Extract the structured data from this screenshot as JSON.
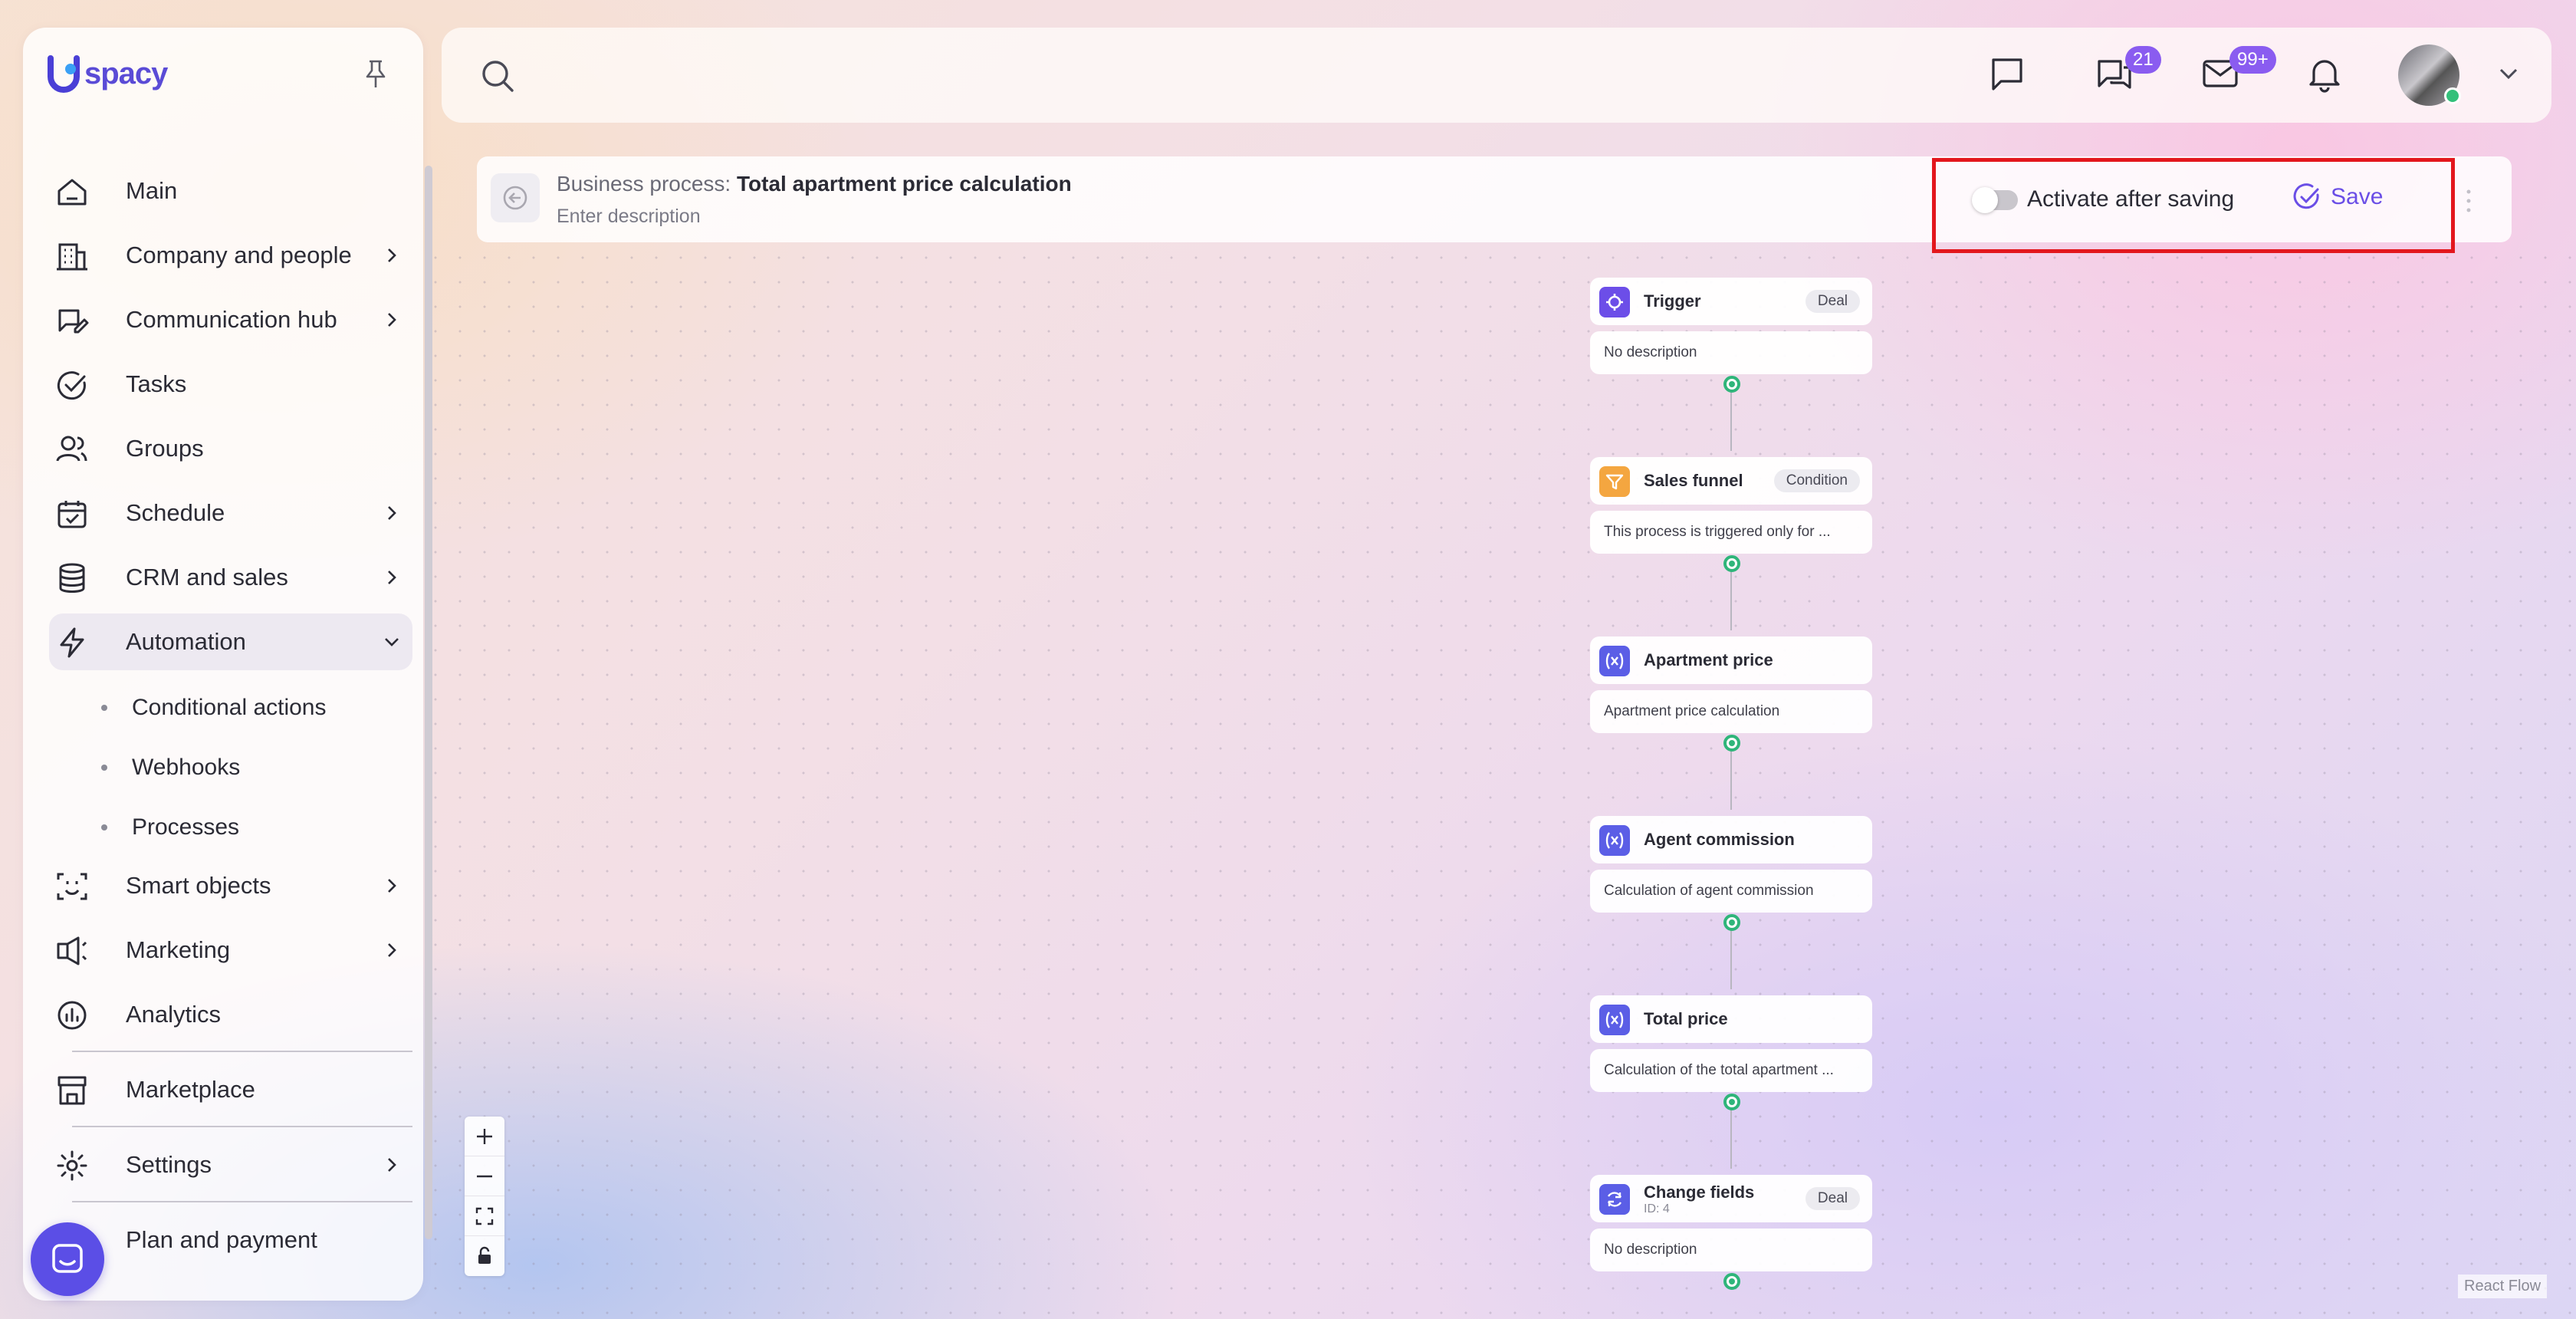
{
  "app": {
    "logo_text": "spacy"
  },
  "sidebar": {
    "items": [
      {
        "label": "Main",
        "icon": "home-icon"
      },
      {
        "label": "Company and people",
        "icon": "building-icon",
        "has_submenu": true
      },
      {
        "label": "Communication hub",
        "icon": "chat-edit-icon",
        "has_submenu": true
      },
      {
        "label": "Tasks",
        "icon": "check-circle-icon"
      },
      {
        "label": "Groups",
        "icon": "users-icon"
      },
      {
        "label": "Schedule",
        "icon": "calendar-icon",
        "has_submenu": true
      },
      {
        "label": "CRM and sales",
        "icon": "database-icon",
        "has_submenu": true
      },
      {
        "label": "Automation",
        "icon": "lightning-icon",
        "has_submenu": true,
        "expanded": true
      }
    ],
    "automation_sub": [
      "Conditional actions",
      "Webhooks",
      "Processes"
    ],
    "items2": [
      {
        "label": "Smart objects",
        "icon": "scan-face-icon",
        "has_submenu": true
      },
      {
        "label": "Marketing",
        "icon": "megaphone-icon",
        "has_submenu": true
      },
      {
        "label": "Analytics",
        "icon": "chart-circle-icon"
      }
    ],
    "marketplace": "Marketplace",
    "settings": "Settings",
    "plan": "Plan and payment"
  },
  "topbar": {
    "chat_badge": "21",
    "mail_badge": "99+",
    "accent": "#8a5cf0"
  },
  "process": {
    "prefix": "Business process:",
    "title": "Total apartment price calculation",
    "description_placeholder": "Enter description",
    "activate_label": "Activate after saving",
    "save_label": "Save"
  },
  "flow": {
    "nodes": [
      {
        "title": "Trigger",
        "tag": "Deal",
        "description": "No description",
        "icon": "target-icon",
        "color": "#6c4ee8"
      },
      {
        "title": "Sales funnel",
        "tag": "Condition",
        "description": "This process is triggered only for ...",
        "icon": "filter-icon",
        "color": "#f4a640"
      },
      {
        "title": "Apartment price",
        "tag": "",
        "description": "Apartment price calculation",
        "icon": "variable-icon",
        "color": "#5b5ee6"
      },
      {
        "title": "Agent commission",
        "tag": "",
        "description": "Calculation of agent commission",
        "icon": "variable-icon",
        "color": "#5b5ee6"
      },
      {
        "title": "Total price",
        "tag": "",
        "description": "Calculation of the total apartment ...",
        "icon": "variable-icon",
        "color": "#5b5ee6"
      },
      {
        "title": "Change fields",
        "subtitle": "ID: 4",
        "tag": "Deal",
        "description": "No description",
        "icon": "refresh-icon",
        "color": "#5b5ee6"
      }
    ],
    "attribution": "React Flow"
  }
}
